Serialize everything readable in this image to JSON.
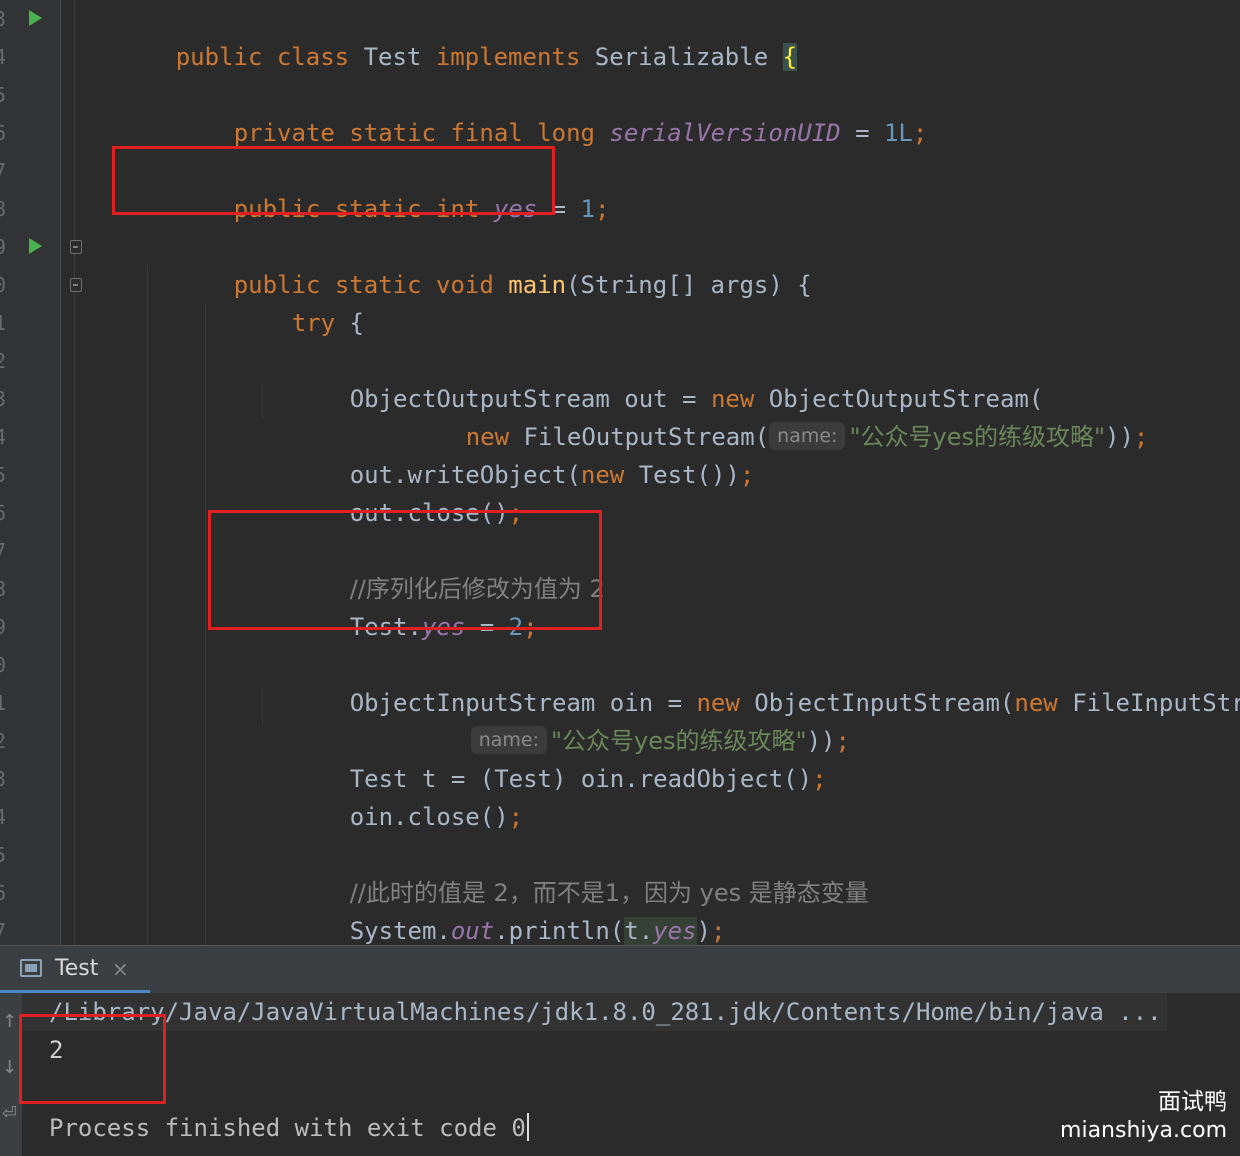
{
  "gutter": {
    "line_numbers": [
      "3",
      "4",
      "5",
      "6",
      "7",
      "8",
      "9",
      "0",
      "1",
      "2",
      "3",
      "4",
      "5",
      "6",
      "7",
      "8",
      "9",
      "0",
      "1",
      "2",
      "3",
      "4",
      "5",
      "6",
      "7"
    ]
  },
  "code": {
    "class_decl": {
      "kw1": "public",
      "kw2": "class",
      "name": "Test",
      "kw3": "implements",
      "iface": "Serializable",
      "brace": "{"
    },
    "serial": {
      "kw1": "private",
      "kw2": "static",
      "kw3": "final",
      "kw4": "long",
      "field": "serialVersionUID",
      "eq": "=",
      "val": "1L",
      "semi": ";"
    },
    "yes_decl": {
      "kw1": "public",
      "kw2": "static",
      "kw3": "int",
      "field": "yes",
      "eq": "=",
      "val": "1",
      "semi": ";"
    },
    "main_decl": {
      "kw1": "public",
      "kw2": "static",
      "kw3": "void",
      "method": "main",
      "rest": "(String[] args) {"
    },
    "try_line": {
      "kw": "try",
      "rest": "{"
    },
    "oos_line1": {
      "pre": "ObjectOutputStream out = ",
      "kw": "new",
      "post": "ObjectOutputStream("
    },
    "oos_line2": {
      "kw": "new",
      "post": "FileOutputStream(",
      "hint": "name:",
      "str": "\"公众号yes的练级攻略\"",
      "end": "))",
      "semi": ";"
    },
    "write_line": {
      "pre": "out.writeObject(",
      "kw": "new",
      "post": "Test())",
      "semi": ";"
    },
    "close_out": {
      "pre": "out.close()",
      "semi": ";"
    },
    "comment1": "//序列化后修改为值为 2",
    "assign_line": {
      "pre": "Test.",
      "field": "yes",
      "eq": "=",
      "val": "2",
      "semi": ";"
    },
    "ois_line1": {
      "pre": "ObjectInputStream oin = ",
      "kw1": "new",
      "mid": "ObjectInputStream(",
      "kw2": "new",
      "post": "FileInputStream("
    },
    "ois_line2": {
      "hint": "name:",
      "str": "\"公众号yes的练级攻略\"",
      "end": "))",
      "semi": ";"
    },
    "read_line": {
      "pre": "Test t = (Test) oin.readObject()",
      "semi": ";"
    },
    "close_oin": {
      "pre": "oin.close()",
      "semi": ";"
    },
    "comment2": "//此时的值是 2，而不是1，因为 yes 是静态变量",
    "print_line": {
      "pre": "System.",
      "field": "out",
      "mid": ".println(",
      "var": "t.",
      "field2": "yes",
      "end": ")",
      "semi": ";"
    }
  },
  "run_panel": {
    "tab_label": "Test",
    "tab_close": "×",
    "command": "/Library/Java/JavaVirtualMachines/jdk1.8.0_281.jdk/Contents/Home/bin/java ...",
    "output_value": "2",
    "exit_message": "Process finished with exit code 0"
  },
  "watermark": {
    "line1": "面试鸭",
    "line2": "mianshiya.com"
  },
  "colors": {
    "keyword": "#cc7832",
    "string": "#6a8759",
    "number": "#6897bb",
    "field": "#9876aa",
    "method": "#ffc66d",
    "comment": "#808080",
    "highlight_box": "#e02020"
  }
}
